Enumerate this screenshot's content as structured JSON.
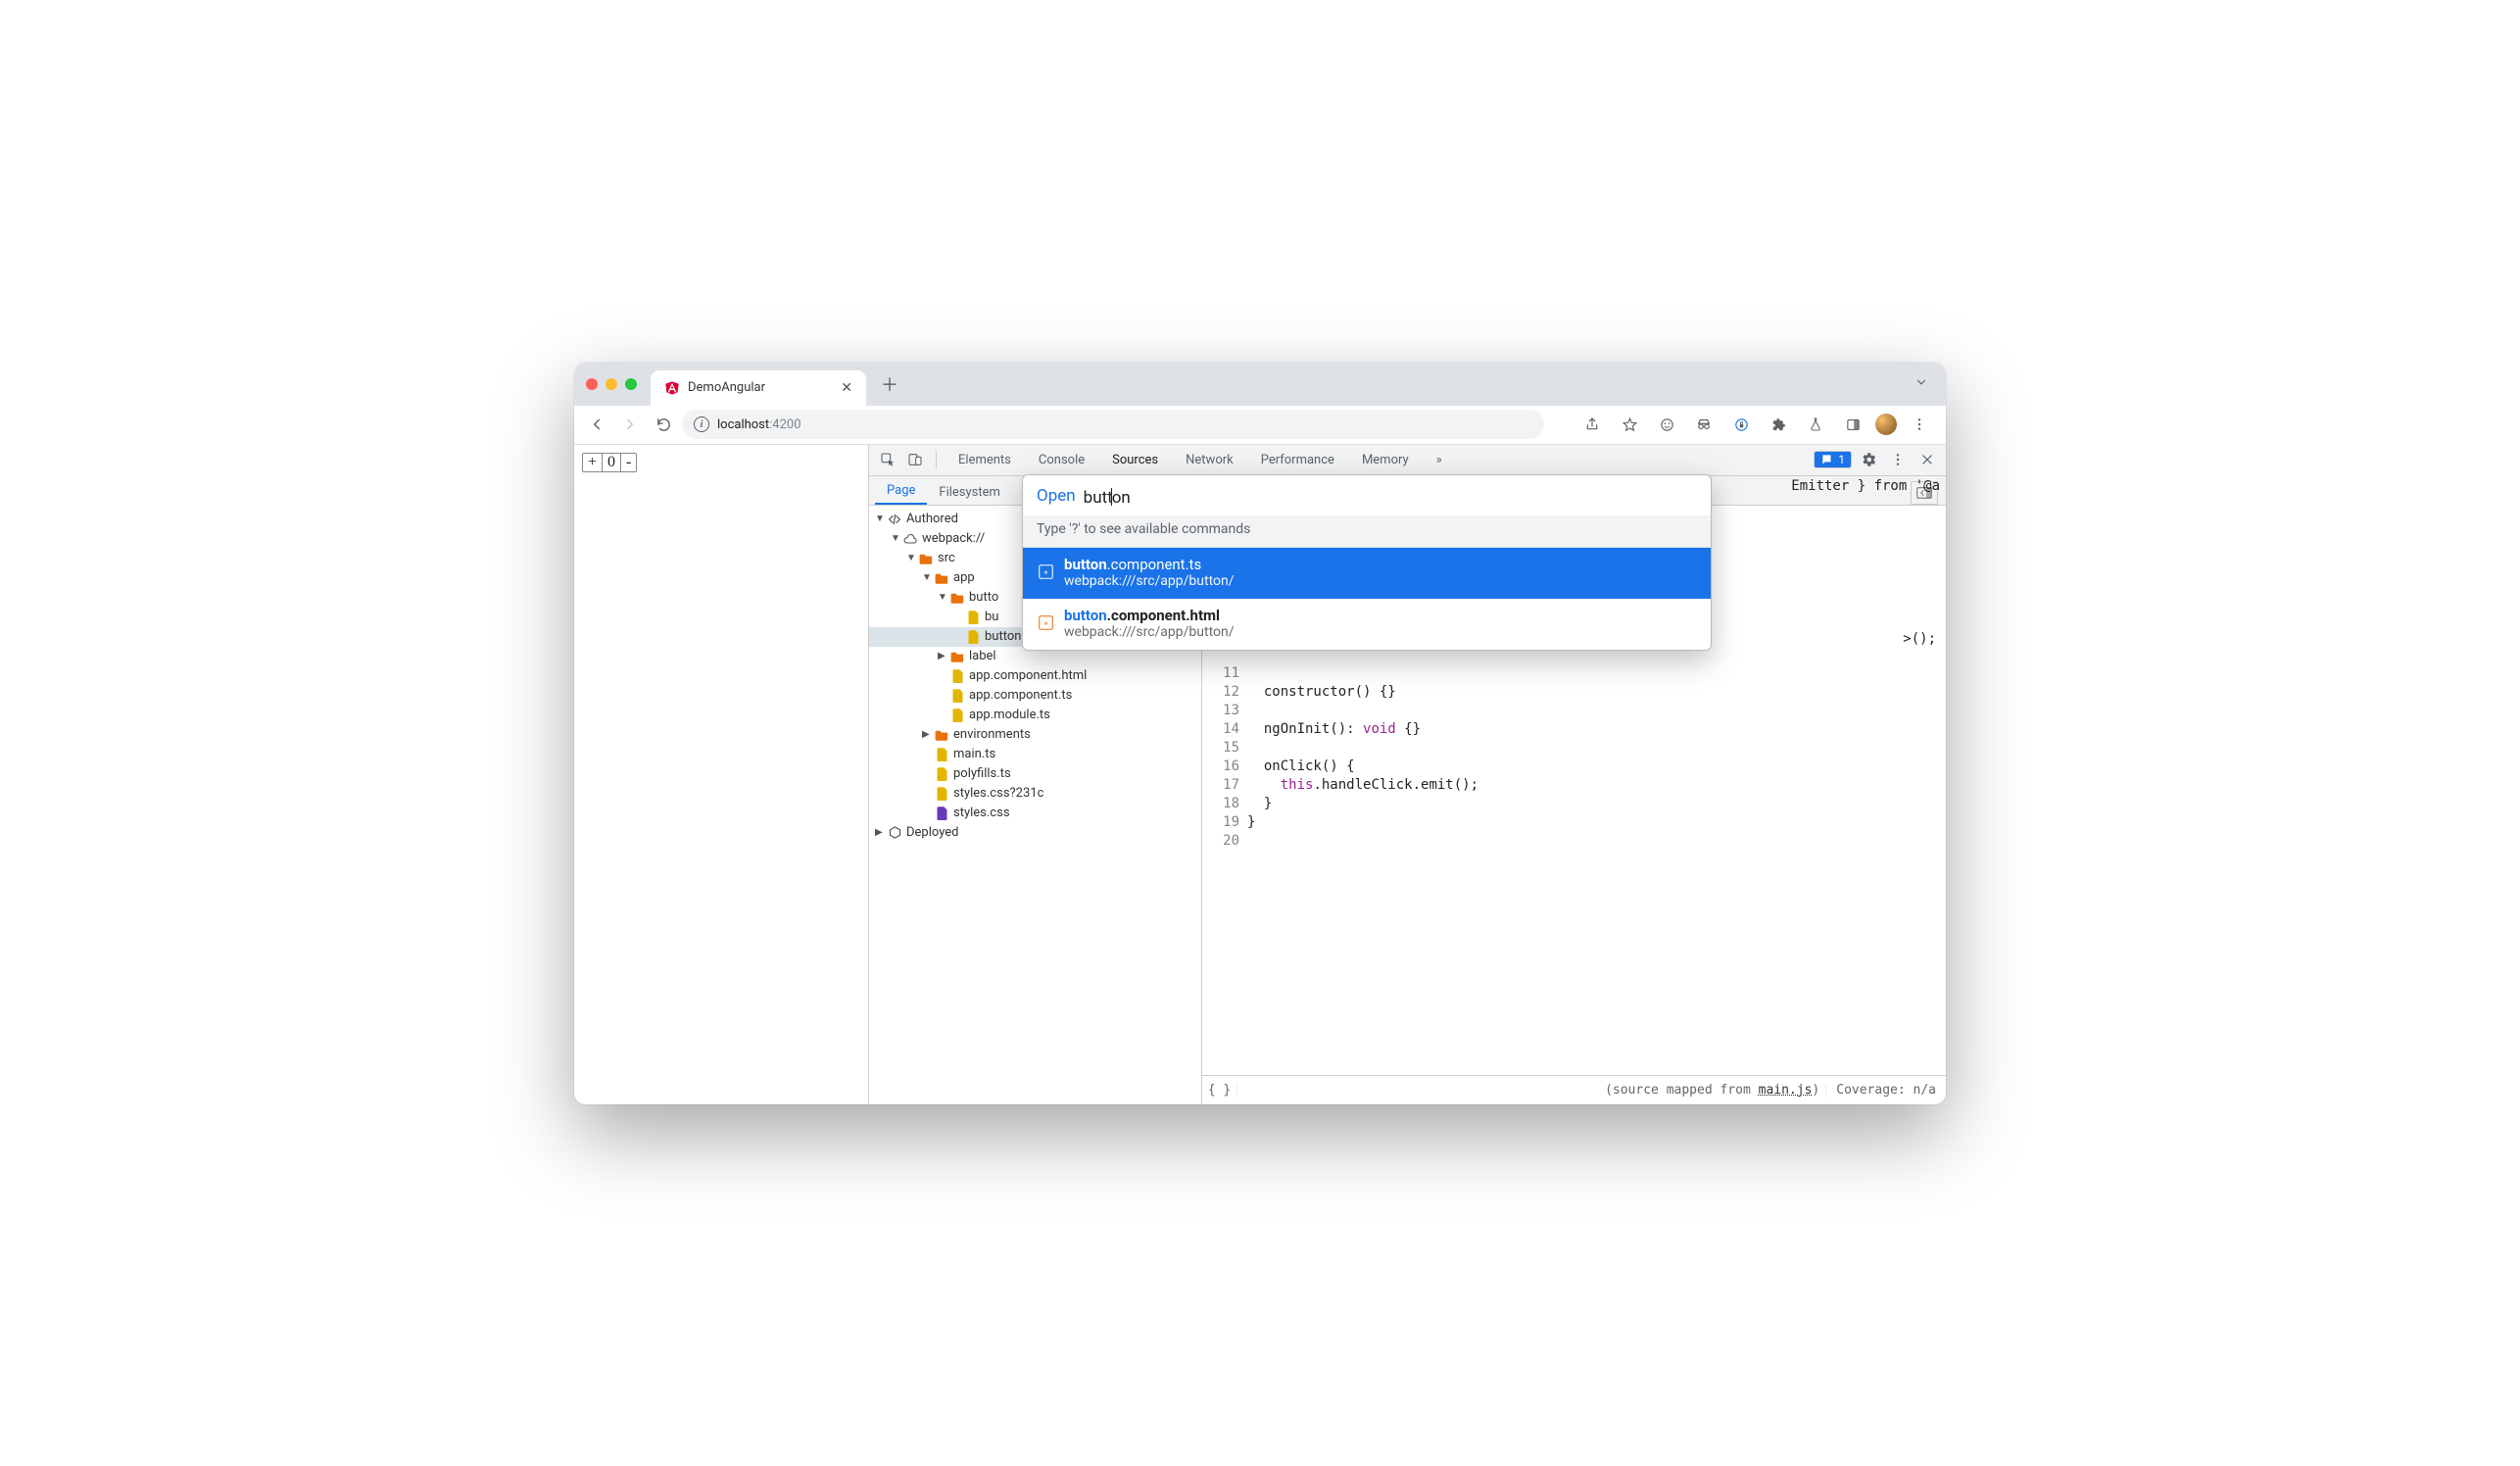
{
  "tab": {
    "title": "DemoAngular"
  },
  "url": {
    "host": "localhost",
    "port": ":4200"
  },
  "page_view": {
    "plus": "+",
    "value": "0",
    "minus": "-"
  },
  "devtools": {
    "panels": [
      "Elements",
      "Console",
      "Sources",
      "Network",
      "Performance",
      "Memory"
    ],
    "active_panel": "Sources",
    "more_panels_glyph": "»",
    "issues_count": "1"
  },
  "sources": {
    "subtabs": [
      "Page",
      "Filesystem"
    ],
    "active_subtab": "Page",
    "tree": {
      "root": "Authored",
      "deployed": "Deployed",
      "webpack": "webpack://",
      "src": "src",
      "app": "app",
      "button": "butto",
      "button_file1": "bu",
      "button_file2": "button.component.ts",
      "label": "label",
      "file_app_html": "app.component.html",
      "file_app_ts": "app.component.ts",
      "file_app_module": "app.module.ts",
      "environments": "environments",
      "main_ts": "main.ts",
      "polyfills": "polyfills.ts",
      "styles_q": "styles.css?231c",
      "styles": "styles.css"
    }
  },
  "open_dialog": {
    "label": "Open",
    "query": "button",
    "hint": "Type '?' to see available commands",
    "results": [
      {
        "match": "button",
        "rest": ".component.ts",
        "path": "webpack:///src/app/button/",
        "selected": true
      },
      {
        "match": "button",
        "rest": ".component.html",
        "path": "webpack:///src/app/button/",
        "selected": false
      }
    ]
  },
  "code": {
    "visible_top_right": "Emitter } from '@a",
    "emitter_tail": ">();",
    "lines": [
      {
        "n": "11",
        "t": ""
      },
      {
        "n": "12",
        "t": "  constructor() {}"
      },
      {
        "n": "13",
        "t": ""
      },
      {
        "n": "14",
        "t": "  ngOnInit(): void {}"
      },
      {
        "n": "15",
        "t": ""
      },
      {
        "n": "16",
        "t": "  onClick() {"
      },
      {
        "n": "17",
        "t": "    this.handleClick.emit();"
      },
      {
        "n": "18",
        "t": "  }"
      },
      {
        "n": "19",
        "t": "}"
      },
      {
        "n": "20",
        "t": ""
      }
    ]
  },
  "footer": {
    "braces": "{ }",
    "mapped_prefix": "(source mapped from ",
    "mapped_link": "main.js",
    "mapped_suffix": ")",
    "coverage": "Coverage: n/a"
  }
}
